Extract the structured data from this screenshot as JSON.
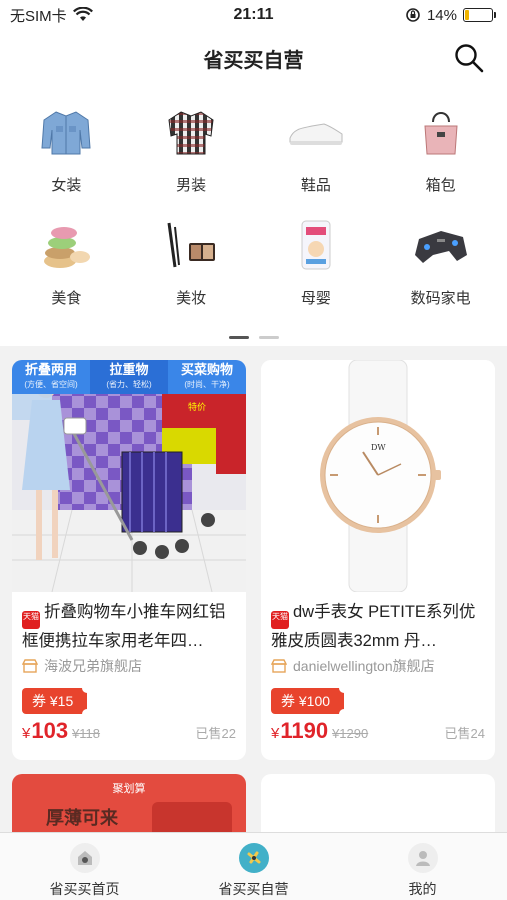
{
  "status_bar": {
    "carrier": "无SIM卡",
    "time": "21:11",
    "battery": "14%",
    "battery_level": 0.14
  },
  "header": {
    "title": "省买买自营"
  },
  "categories": [
    {
      "label": "女装",
      "icon": "denim-jacket-icon"
    },
    {
      "label": "男装",
      "icon": "plaid-shirt-icon"
    },
    {
      "label": "鞋品",
      "icon": "sneaker-icon"
    },
    {
      "label": "箱包",
      "icon": "handbag-icon"
    },
    {
      "label": "美食",
      "icon": "macaron-icon"
    },
    {
      "label": "美妆",
      "icon": "makeup-brush-icon"
    },
    {
      "label": "母婴",
      "icon": "diaper-pack-icon"
    },
    {
      "label": "数码家电",
      "icon": "gamepad-icon"
    }
  ],
  "pager": {
    "pages": 2,
    "active": 0
  },
  "products": [
    {
      "title": "折叠购物车小推车网红铝框便携拉车家用老年四…",
      "shop": "海波兄弟旗舰店",
      "coupon": "券 ¥15",
      "currency": "¥",
      "price": "103",
      "original_price": "¥118",
      "sold": "已售22",
      "badge": "天猫",
      "banner": [
        {
          "main": "折叠两用",
          "sub": "(方便、省空间)"
        },
        {
          "main": "拉重物",
          "sub": "(省力、轻松)"
        },
        {
          "main": "买菜购物",
          "sub": "(时尚、干净)"
        }
      ],
      "sign_text": "特价"
    },
    {
      "title": "dw手表女 PETITE系列优雅皮质圆表32mm 丹…",
      "shop": "danielwellington旗舰店",
      "coupon": "券 ¥100",
      "currency": "¥",
      "price": "1190",
      "original_price": "¥1290",
      "sold": "已售24",
      "badge": "天猫",
      "dial_text": "DW"
    },
    {
      "title": "",
      "promo_text_1": "厚薄可来",
      "brand_text": "聚划算"
    }
  ],
  "tabs": [
    {
      "label": "省买买首页",
      "icon": "home-icon"
    },
    {
      "label": "省买买自营",
      "icon": "store-icon"
    },
    {
      "label": "我的",
      "icon": "profile-icon"
    }
  ],
  "colors": {
    "price_red": "#e0242a",
    "coupon_red": "#e8442d",
    "banner_blue": "#2b7be4"
  }
}
